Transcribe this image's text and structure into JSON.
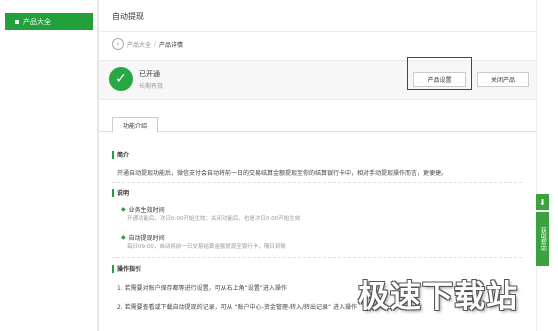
{
  "sidebar": {
    "items": [
      {
        "label": "产品大全"
      }
    ]
  },
  "page": {
    "title": "自动提现"
  },
  "breadcrumb": {
    "parent": "产品大全",
    "separator": "/",
    "current": "产品详情"
  },
  "status": {
    "title": "已开通",
    "subtitle": "长期有效"
  },
  "actions": {
    "settings_label": "产品设置",
    "close_label": "关闭产品"
  },
  "tabs": [
    {
      "label": "功能介绍"
    }
  ],
  "intro": {
    "heading": "简介",
    "text": "开通自动提现功能后，微信支付会自动将前一日的交易结算金额提现至你的结算银行卡中，相对手动提现操作而言，更便捷。"
  },
  "notes": {
    "heading": "说明",
    "items": [
      {
        "title": "业务生效时间",
        "desc": "开通功能后，次日0:00开始生效；关闭功能后，也是次日0:00开始生效"
      },
      {
        "title": "自动提现时间",
        "desc": "每日09:00，自动将前一日交易结算金额提现至银行卡，隔日到账"
      }
    ]
  },
  "guide": {
    "heading": "操作指引",
    "steps": [
      "1. 若需要对账户保存都等进行设置，可从右上角“设置”进入操作",
      "2. 若需要查看或下载自动提现的记录，可从 “账户中心-资金管理-转入/转出记录” 进入操作"
    ]
  },
  "float": {
    "download_icon": "download-icon",
    "help_label": "获取帮助"
  },
  "watermark": "极速下载站",
  "colors": {
    "accent": "#21a03c",
    "highlight": "#e60012"
  }
}
